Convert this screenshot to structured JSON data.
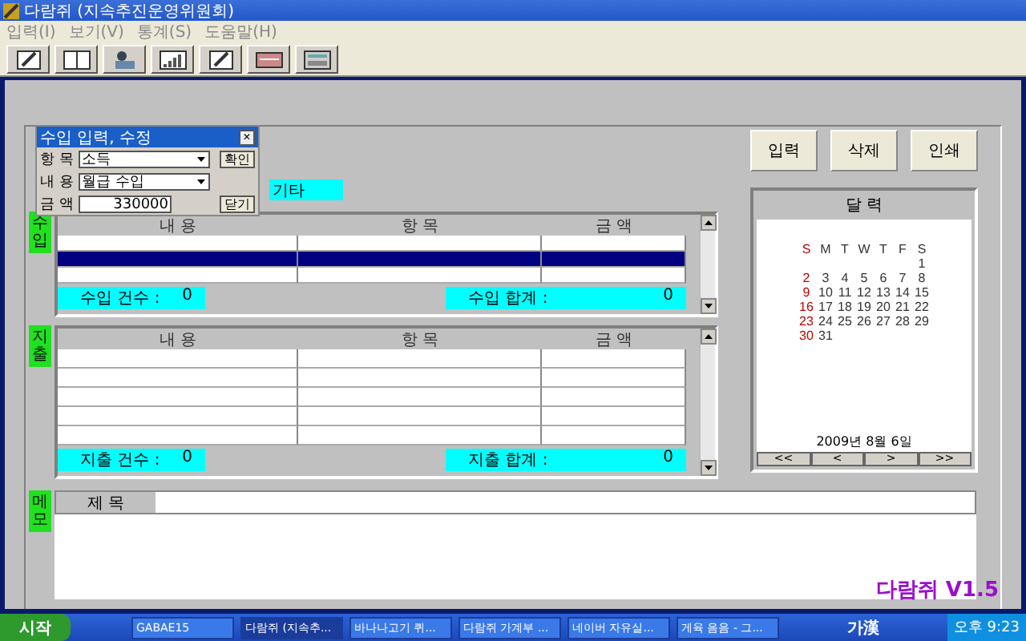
{
  "window": {
    "title": "다람쥐 (지속추진운영위원회)"
  },
  "menu": [
    "입력(I)",
    "보기(V)",
    "통계(S)",
    "도움말(H)"
  ],
  "toolbar": [
    {
      "kind": "pencil"
    },
    {
      "kind": "book"
    },
    {
      "kind": "figure"
    },
    {
      "kind": "chart"
    },
    {
      "kind": "pencil"
    },
    {
      "kind": "screen"
    },
    {
      "kind": "calculator"
    }
  ],
  "dialog": {
    "title": "수입 입력, 수정",
    "close": "×",
    "fields": [
      {
        "label": "항 목",
        "value": "소득",
        "kind": "select"
      },
      {
        "label": "내 용",
        "value": "월급 수입",
        "kind": "select"
      },
      {
        "label": "금 액",
        "value": "330000",
        "kind": "input"
      }
    ],
    "buttons": [
      "확인",
      "닫기"
    ]
  },
  "hidden_field": "기타",
  "actions": [
    "입력",
    "삭제",
    "인쇄"
  ],
  "income": {
    "label": "수입",
    "columns": [
      "내 용",
      "항 목",
      "금 액"
    ],
    "rows": [
      {
        "selected": false
      },
      {
        "selected": true
      },
      {
        "selected": false
      }
    ],
    "footer": [
      {
        "label": "수입 건수 :",
        "value": "0"
      },
      {
        "label": "수입 합계 :",
        "value": "0"
      }
    ]
  },
  "expense": {
    "label": "지출",
    "columns": [
      "내 용",
      "항 목",
      "금 액"
    ],
    "rows": [
      {
        "selected": false
      },
      {
        "selected": false
      },
      {
        "selected": false
      },
      {
        "selected": false
      },
      {
        "selected": false
      }
    ],
    "footer": [
      {
        "label": "지출 건수 :",
        "value": "0"
      },
      {
        "label": "지출 합계 :",
        "value": "0"
      }
    ]
  },
  "calendar": {
    "title": "달 력",
    "weekdays": [
      "S",
      "M",
      "T",
      "W",
      "T",
      "F",
      "S"
    ],
    "weeks": [
      [
        "1"
      ],
      [
        "2",
        "3",
        "4",
        "5",
        "6",
        "7",
        "8"
      ],
      [
        "9",
        "10",
        "11",
        "12",
        "13",
        "14",
        "15"
      ],
      [
        "16",
        "17",
        "18",
        "19",
        "20",
        "21",
        "22"
      ],
      [
        "23",
        "24",
        "25",
        "26",
        "27",
        "28",
        "29"
      ],
      [
        "30",
        "31"
      ]
    ],
    "date": "2009년  8월  6일",
    "nav": [
      "<<",
      "<",
      ">",
      ">>"
    ]
  },
  "memo": {
    "label": "메모",
    "title_label": "제 목"
  },
  "overlay": "다람쥐 V1.5",
  "taskbar": {
    "start": "시작",
    "items": [
      {
        "label": "GABAE15",
        "selected": false
      },
      {
        "label": "다람쥐 (지속추...",
        "selected": true
      },
      {
        "label": "바나나고기 퀴...",
        "selected": false
      },
      {
        "label": "다람쥐 가계부 ...",
        "selected": false
      },
      {
        "label": "네이버 자유실...",
        "selected": false
      },
      {
        "label": "게육 음음 - 그...",
        "selected": false
      }
    ],
    "ime": "가漢",
    "clock": "오후 9:23"
  }
}
